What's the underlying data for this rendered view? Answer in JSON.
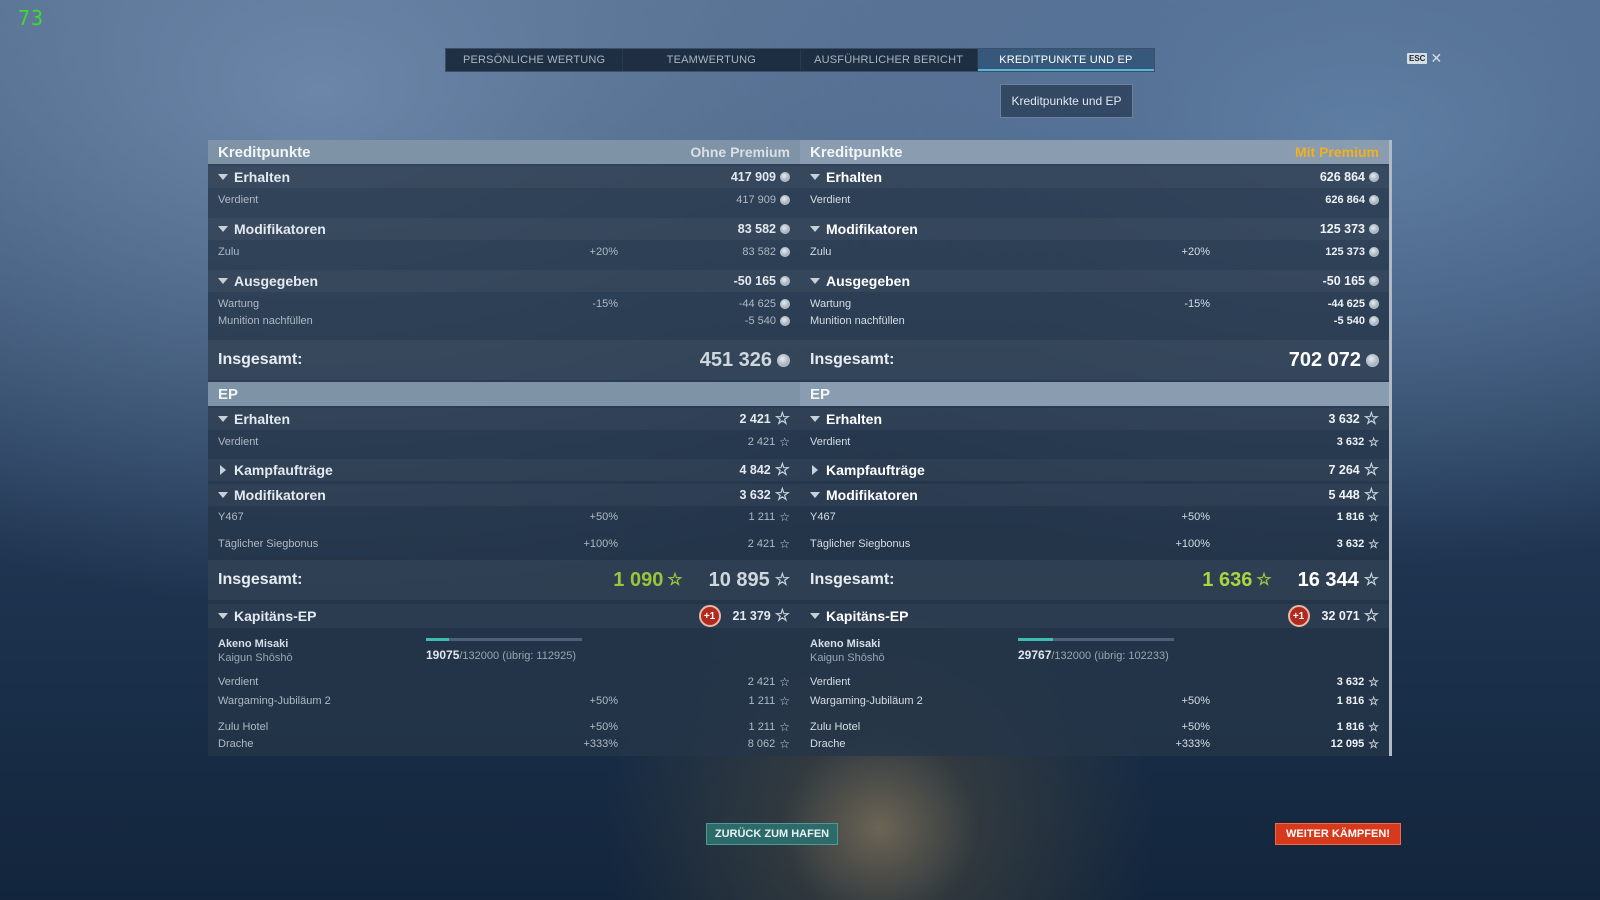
{
  "overlay": {
    "fps": "73"
  },
  "tabs": [
    {
      "label": "PERSÖNLICHE WERTUNG"
    },
    {
      "label": "TEAMWERTUNG"
    },
    {
      "label": "AUSFÜHRLICHER BERICHT"
    },
    {
      "label": "KREDITPUNKTE UND EP"
    }
  ],
  "esc": {
    "key": "ESC",
    "close": "✕"
  },
  "subtab": "Kreditpunkte und EP",
  "left": {
    "credits_title": "Kreditpunkte",
    "credits_subtitle": "Ohne Premium",
    "received": {
      "label": "Erhalten",
      "value": "417 909"
    },
    "earned": {
      "label": "Verdient",
      "value": "417 909"
    },
    "modifiers": {
      "label": "Modifikatoren",
      "value": "83 582"
    },
    "zulu": {
      "label": "Zulu",
      "pct": "+20%",
      "value": "83 582"
    },
    "spent": {
      "label": "Ausgegeben",
      "value": "-50 165"
    },
    "maintenance": {
      "label": "Wartung",
      "pct": "-15%",
      "value": "-44 625"
    },
    "ammo": {
      "label": "Munition nachfüllen",
      "value": "-5 540"
    },
    "credits_total": {
      "label": "Insgesamt:",
      "value": "451 326"
    },
    "xp_title": "EP",
    "xp_received": {
      "label": "Erhalten",
      "value": "2 421"
    },
    "xp_earned": {
      "label": "Verdient",
      "value": "2 421"
    },
    "combat_missions": {
      "label": "Kampfaufträge",
      "value": "4 842"
    },
    "xp_modifiers": {
      "label": "Modifikatoren",
      "value": "3 632"
    },
    "y467": {
      "label": "Y467",
      "pct": "+50%",
      "value": "1 211"
    },
    "daily_bonus": {
      "label": "Täglicher Siegbonus",
      "pct": "+100%",
      "value": "2 421"
    },
    "xp_total": {
      "label": "Insgesamt:",
      "free_value": "1 090",
      "value": "10 895"
    },
    "captain": {
      "label": "Kapitäns-EP",
      "badge": "+1",
      "value": "21 379",
      "name": "Akeno Misaki",
      "rank": "Kaigun Shōshō",
      "progress_current": "19075",
      "progress_rest": "/132000  (übrig: 112925)",
      "progress_fraction": 0.145
    },
    "cap_earned": {
      "label": "Verdient",
      "value": "2 421"
    },
    "wg_jubilee": {
      "label": "Wargaming-Jubiläum 2",
      "pct": "+50%",
      "value": "1 211"
    },
    "zulu_hotel": {
      "label": "Zulu Hotel",
      "pct": "+50%",
      "value": "1 211"
    },
    "drache": {
      "label": "Drache",
      "pct": "+333%",
      "value": "8 062"
    }
  },
  "right": {
    "credits_title": "Kreditpunkte",
    "credits_subtitle": "Mit Premium",
    "received": {
      "label": "Erhalten",
      "value": "626 864"
    },
    "earned": {
      "label": "Verdient",
      "value": "626 864"
    },
    "modifiers": {
      "label": "Modifikatoren",
      "value": "125 373"
    },
    "zulu": {
      "label": "Zulu",
      "pct": "+20%",
      "value": "125 373"
    },
    "spent": {
      "label": "Ausgegeben",
      "value": "-50 165"
    },
    "maintenance": {
      "label": "Wartung",
      "pct": "-15%",
      "value": "-44 625"
    },
    "ammo": {
      "label": "Munition nachfüllen",
      "value": "-5 540"
    },
    "credits_total": {
      "label": "Insgesamt:",
      "value": "702 072"
    },
    "xp_title": "EP",
    "xp_received": {
      "label": "Erhalten",
      "value": "3 632"
    },
    "xp_earned": {
      "label": "Verdient",
      "value": "3 632"
    },
    "combat_missions": {
      "label": "Kampfaufträge",
      "value": "7 264"
    },
    "xp_modifiers": {
      "label": "Modifikatoren",
      "value": "5 448"
    },
    "y467": {
      "label": "Y467",
      "pct": "+50%",
      "value": "1 816"
    },
    "daily_bonus": {
      "label": "Täglicher Siegbonus",
      "pct": "+100%",
      "value": "3 632"
    },
    "xp_total": {
      "label": "Insgesamt:",
      "free_value": "1 636",
      "value": "16 344"
    },
    "captain": {
      "label": "Kapitäns-EP",
      "badge": "+1",
      "value": "32 071",
      "name": "Akeno Misaki",
      "rank": "Kaigun Shōshō",
      "progress_current": "29767",
      "progress_rest": "/132000  (übrig: 102233)",
      "progress_fraction": 0.225
    },
    "cap_earned": {
      "label": "Verdient",
      "value": "3 632"
    },
    "wg_jubilee": {
      "label": "Wargaming-Jubiläum 2",
      "pct": "+50%",
      "value": "1 816"
    },
    "zulu_hotel": {
      "label": "Zulu Hotel",
      "pct": "+50%",
      "value": "1 816"
    },
    "drache": {
      "label": "Drache",
      "pct": "+333%",
      "value": "12 095"
    }
  },
  "buttons": {
    "back": "ZURÜCK ZUM HAFEN",
    "fight": "WEITER KÄMPFEN!"
  },
  "colors": {
    "premium_gold": "#f0b020",
    "free_xp_green": "#a9d63f",
    "fight_button": "#d6391b",
    "back_button": "#2d6a6a",
    "progress_fill": "#3dbdb2"
  }
}
